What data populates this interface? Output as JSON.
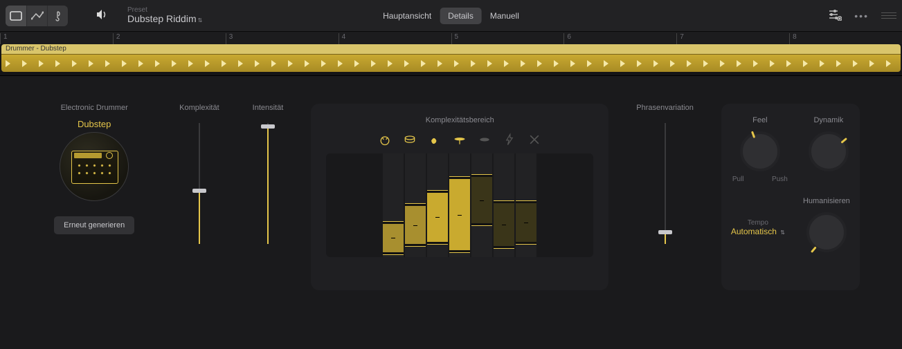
{
  "header": {
    "preset_label": "Preset",
    "preset_value": "Dubstep Riddim",
    "tabs": [
      "Hauptansicht",
      "Details",
      "Manuell"
    ],
    "active_tab": 1
  },
  "timeline": {
    "region_title": "Drummer - Dubstep",
    "markers": [
      1,
      2,
      3,
      4,
      5,
      6,
      7,
      8
    ]
  },
  "drummer": {
    "category": "Electronic Drummer",
    "style": "Dubstep",
    "regen_label": "Erneut generieren"
  },
  "sliders": {
    "komplexitaet": {
      "label": "Komplexität",
      "value": 0.44
    },
    "intensitaet": {
      "label": "Intensität",
      "value": 0.97
    },
    "phrasen": {
      "label": "Phrasenvariation",
      "value": 0.1
    }
  },
  "complexity_range": {
    "title": "Komplexitätsbereich",
    "icons": [
      "kick-icon",
      "snare-icon",
      "clap-icon",
      "hihat-icon",
      "perc-icon",
      "fx-icon",
      "cross-icon"
    ],
    "lanes": [
      {
        "lo": 0.02,
        "hi": 0.35,
        "lit": true,
        "bright": false
      },
      {
        "lo": 0.1,
        "hi": 0.52,
        "lit": true,
        "bright": false
      },
      {
        "lo": 0.12,
        "hi": 0.65,
        "lit": true,
        "bright": true
      },
      {
        "lo": 0.04,
        "hi": 0.78,
        "lit": true,
        "bright": true
      },
      {
        "lo": 0.3,
        "hi": 0.8,
        "lit": false,
        "bright": false
      },
      {
        "lo": 0.08,
        "hi": 0.55,
        "lit": false,
        "bright": false
      },
      {
        "lo": 0.12,
        "hi": 0.55,
        "lit": false,
        "bright": false
      }
    ]
  },
  "knobs": {
    "feel": {
      "label": "Feel",
      "angle": -20,
      "sub_left": "Pull",
      "sub_right": "Push"
    },
    "dynamik": {
      "label": "Dynamik",
      "angle": 50
    },
    "humanisieren": {
      "label": "Humanisieren",
      "angle": -140
    }
  },
  "tempo": {
    "label": "Tempo",
    "value": "Automatisch"
  }
}
